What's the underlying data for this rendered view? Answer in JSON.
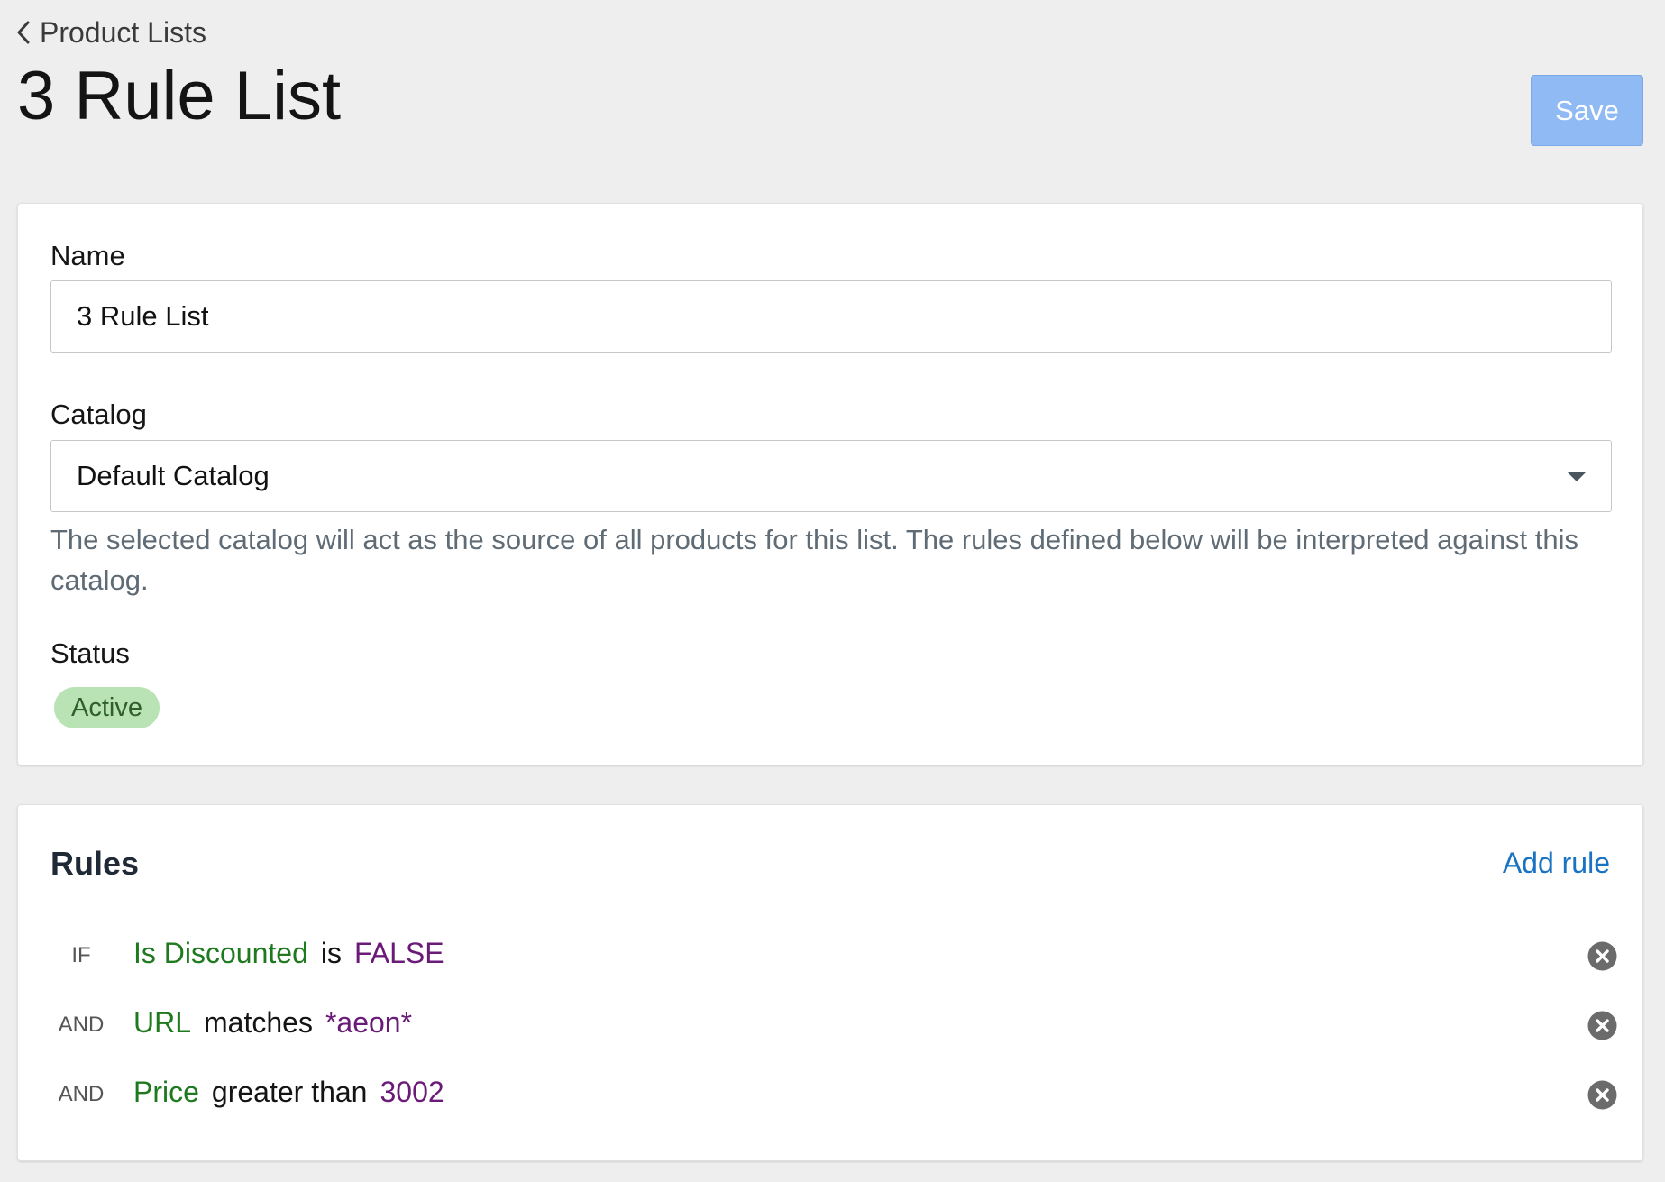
{
  "header": {
    "back_label": "Product Lists",
    "title": "3 Rule List",
    "save_label": "Save"
  },
  "details": {
    "name_label": "Name",
    "name_value": "3 Rule List",
    "catalog_label": "Catalog",
    "catalog_value": "Default Catalog",
    "catalog_help": "The selected catalog will act as the source of all products for this list. The rules defined below will be interpreted against this catalog.",
    "status_label": "Status",
    "status_value": "Active"
  },
  "rules": {
    "title": "Rules",
    "add_label": "Add rule",
    "items": [
      {
        "conjunction": "IF",
        "field": "Is Discounted",
        "operator": "is",
        "value": "FALSE"
      },
      {
        "conjunction": "AND",
        "field": "URL",
        "operator": "matches",
        "value": "*aeon*"
      },
      {
        "conjunction": "AND",
        "field": "Price",
        "operator": "greater than",
        "value": "3002"
      }
    ]
  },
  "icons": {
    "back": "chevron-left-icon",
    "select": "caret-down-icon",
    "remove": "close-circle-icon"
  },
  "colors": {
    "save_button_disabled": "#8fbaf3",
    "status_active_bg": "#b9e3b4",
    "rule_field": "#1f7a1f",
    "rule_value": "#6a1b78",
    "link": "#1a73c2"
  }
}
